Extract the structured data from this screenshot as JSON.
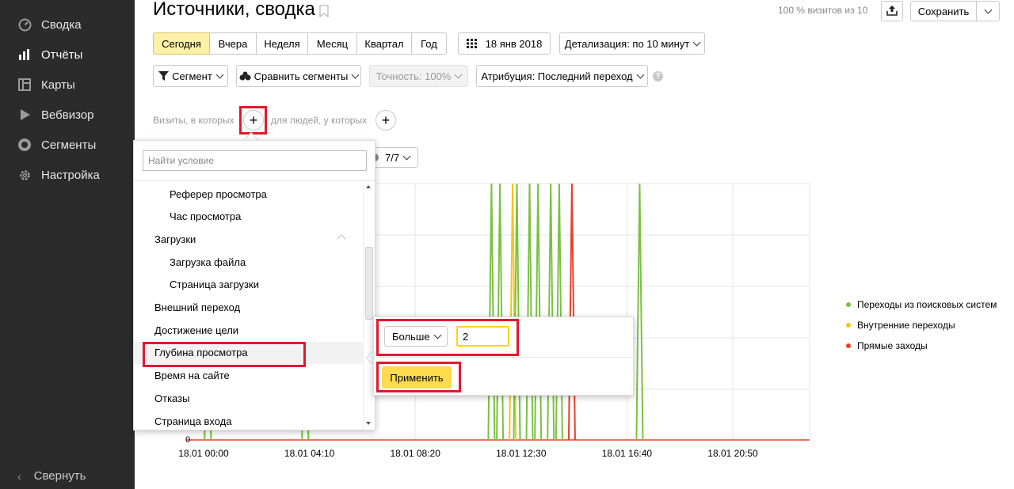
{
  "sidebar": {
    "items": [
      {
        "label": "Сводка",
        "icon": "dashboard-icon"
      },
      {
        "label": "Отчёты",
        "icon": "bar-chart-icon"
      },
      {
        "label": "Карты",
        "icon": "map-icon"
      },
      {
        "label": "Вебвизор",
        "icon": "play-icon"
      },
      {
        "label": "Сегменты",
        "icon": "segments-icon"
      },
      {
        "label": "Настройка",
        "icon": "gear-icon"
      }
    ],
    "collapse_label": "Свернуть"
  },
  "header": {
    "title": "Источники, сводка",
    "visits_note": "100 % визитов из 10",
    "save_label": "Сохранить"
  },
  "periods": [
    "Сегодня",
    "Вчера",
    "Неделя",
    "Месяц",
    "Квартал",
    "Год"
  ],
  "date_label": "18 янв 2018",
  "detail_label": "Детализация: по 10 минут",
  "toolbar": {
    "segment_label": "Сегмент",
    "compare_label": "Сравнить сегменты",
    "accuracy_label": "Точность: 100%",
    "attribution_label": "Атрибуция: Последний переход"
  },
  "conditions": {
    "visits_label": "Визиты, в которых",
    "people_label": "для людей, у которых"
  },
  "series_filter_label": "7/7",
  "dropdown": {
    "search_placeholder": "Найти условие",
    "items": [
      {
        "label": "Реферер просмотра",
        "level": "child"
      },
      {
        "label": "Час просмотра",
        "level": "child"
      },
      {
        "label": "Загрузки",
        "level": "parent"
      },
      {
        "label": "Загрузка файла",
        "level": "child"
      },
      {
        "label": "Страница загрузки",
        "level": "child"
      },
      {
        "label": "Внешний переход",
        "level": "parent"
      },
      {
        "label": "Достижение цели",
        "level": "parent"
      },
      {
        "label": "Глубина просмотра",
        "level": "parent"
      },
      {
        "label": "Время на сайте",
        "level": "parent"
      },
      {
        "label": "Отказы",
        "level": "parent"
      },
      {
        "label": "Страница входа",
        "level": "parent"
      }
    ]
  },
  "condition_popup": {
    "operator": "Больше",
    "value": "2",
    "apply_label": "Применить"
  },
  "chart_data": {
    "type": "line",
    "x_tick_labels": [
      "18.01 00:00",
      "18.01 04:10",
      "18.01 08:20",
      "18.01 12:30",
      "18.01 16:40",
      "18.01 20:50"
    ],
    "y_tick_labels": [
      "0"
    ],
    "series": [
      {
        "name": "Переходы из поисковых систем",
        "color": "#7ac142"
      },
      {
        "name": "Внутренние переходы",
        "color": "#f5c518"
      },
      {
        "name": "Прямые заходы",
        "color": "#e8402a"
      }
    ],
    "spikes": [
      {
        "series": 0,
        "x": "18.01 00:10"
      },
      {
        "series": 0,
        "x": "18.01 04:00"
      },
      {
        "series": 0,
        "x": "18.01 11:20"
      },
      {
        "series": 0,
        "x": "18.01 11:40"
      },
      {
        "series": 1,
        "x": "18.01 12:10"
      },
      {
        "series": 0,
        "x": "18.01 12:20"
      },
      {
        "series": 0,
        "x": "18.01 12:50"
      },
      {
        "series": 0,
        "x": "18.01 13:10"
      },
      {
        "series": 0,
        "x": "18.01 13:40"
      },
      {
        "series": 0,
        "x": "18.01 14:00"
      },
      {
        "series": 2,
        "x": "18.01 14:30"
      },
      {
        "series": 0,
        "x": "18.01 17:10"
      }
    ],
    "grid": true,
    "legend_position": "right"
  }
}
